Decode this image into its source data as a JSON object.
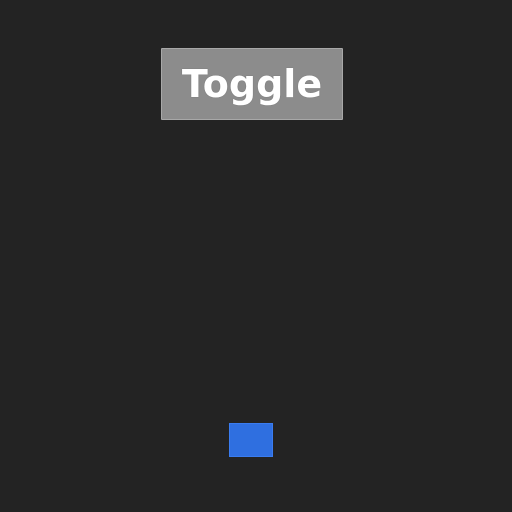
{
  "controls": {
    "toggle_label": "Toggle"
  },
  "colors": {
    "background": "#232323",
    "button_fill": "#8c8c8c",
    "button_text": "#ffffff",
    "square_fill": "#2f6fe0"
  }
}
